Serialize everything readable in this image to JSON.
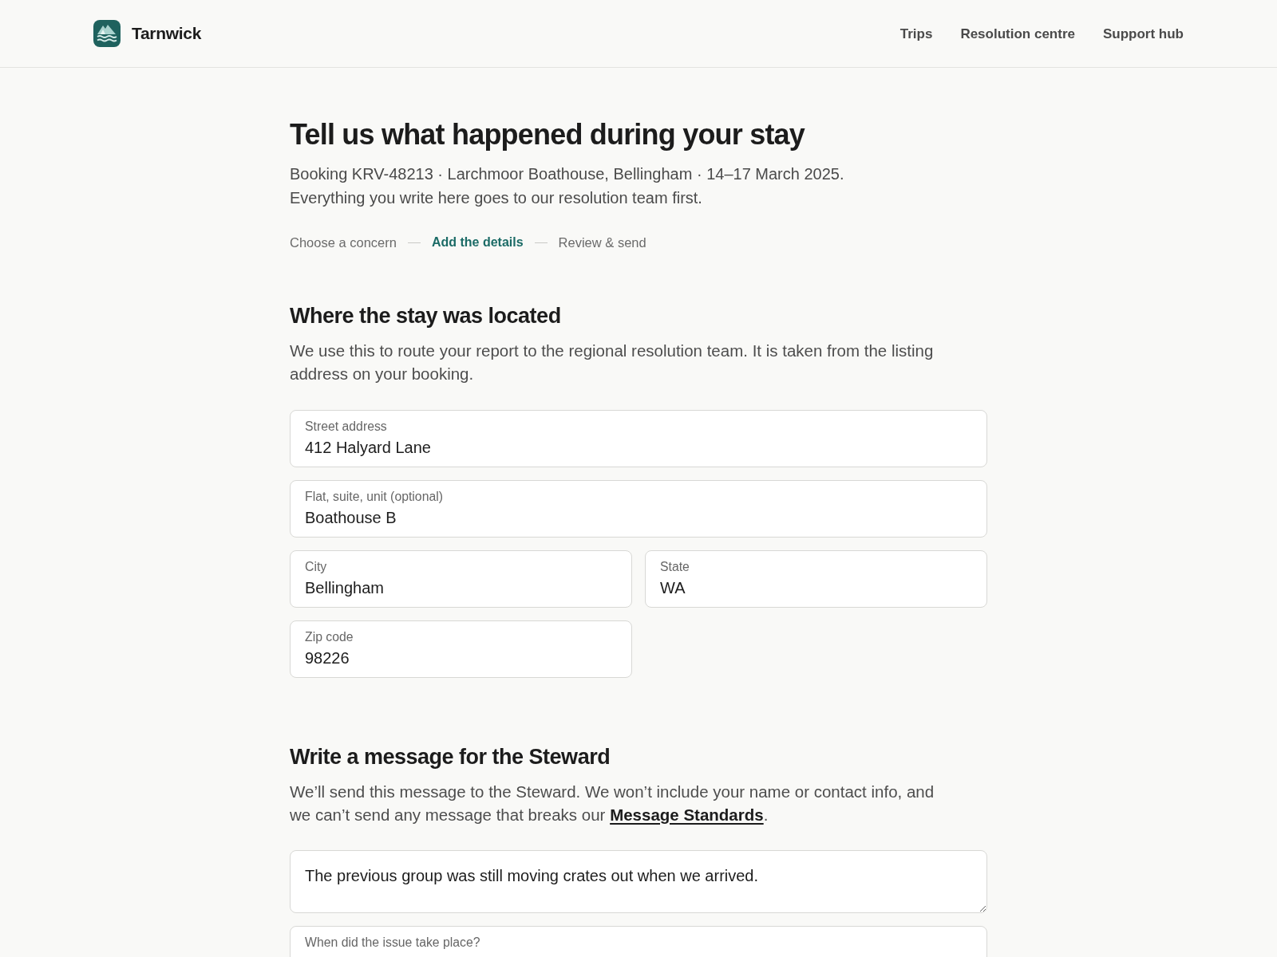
{
  "header": {
    "brand": "Tarnwick",
    "nav": [
      {
        "label": "Trips"
      },
      {
        "label": "Resolution centre"
      },
      {
        "label": "Support hub"
      }
    ]
  },
  "intro": {
    "title": "Tell us what happened during your stay",
    "subtitle_lines": [
      "Booking KRV-48213 · Larchmoor Boathouse, Bellingham · 14–17 March 2025.",
      "Everything you write here goes to our resolution team first."
    ],
    "steps": [
      {
        "label": "Choose a concern",
        "selected": false
      },
      {
        "label": "Add the details",
        "selected": true
      },
      {
        "label": "Review & send",
        "selected": false
      }
    ]
  },
  "location": {
    "heading": "Where the stay was located",
    "description": "We use this to route your report to the regional resolution team. It is taken from the listing address on your booking.",
    "street": {
      "label": "Street address",
      "value": "412 Halyard Lane"
    },
    "unit": {
      "label": "Flat, suite, unit (optional)",
      "value": "Boathouse B"
    },
    "city": {
      "label": "City",
      "value": "Bellingham"
    },
    "state": {
      "label": "State",
      "value": "WA"
    },
    "zip": {
      "label": "Zip code",
      "value": "98226"
    }
  },
  "message": {
    "heading": "Write a message for the Steward",
    "description": [
      {
        "kind": "text",
        "text": "We’ll send this message to the Steward. We won’t include your name or contact info, and we can’t send any message that breaks our "
      },
      {
        "kind": "link",
        "text": "Message Standards"
      },
      {
        "kind": "text",
        "text": "."
      }
    ],
    "text": "The previous group was still moving crates out when we arrived.",
    "date_select": {
      "label": "When did the issue take place?"
    }
  }
}
